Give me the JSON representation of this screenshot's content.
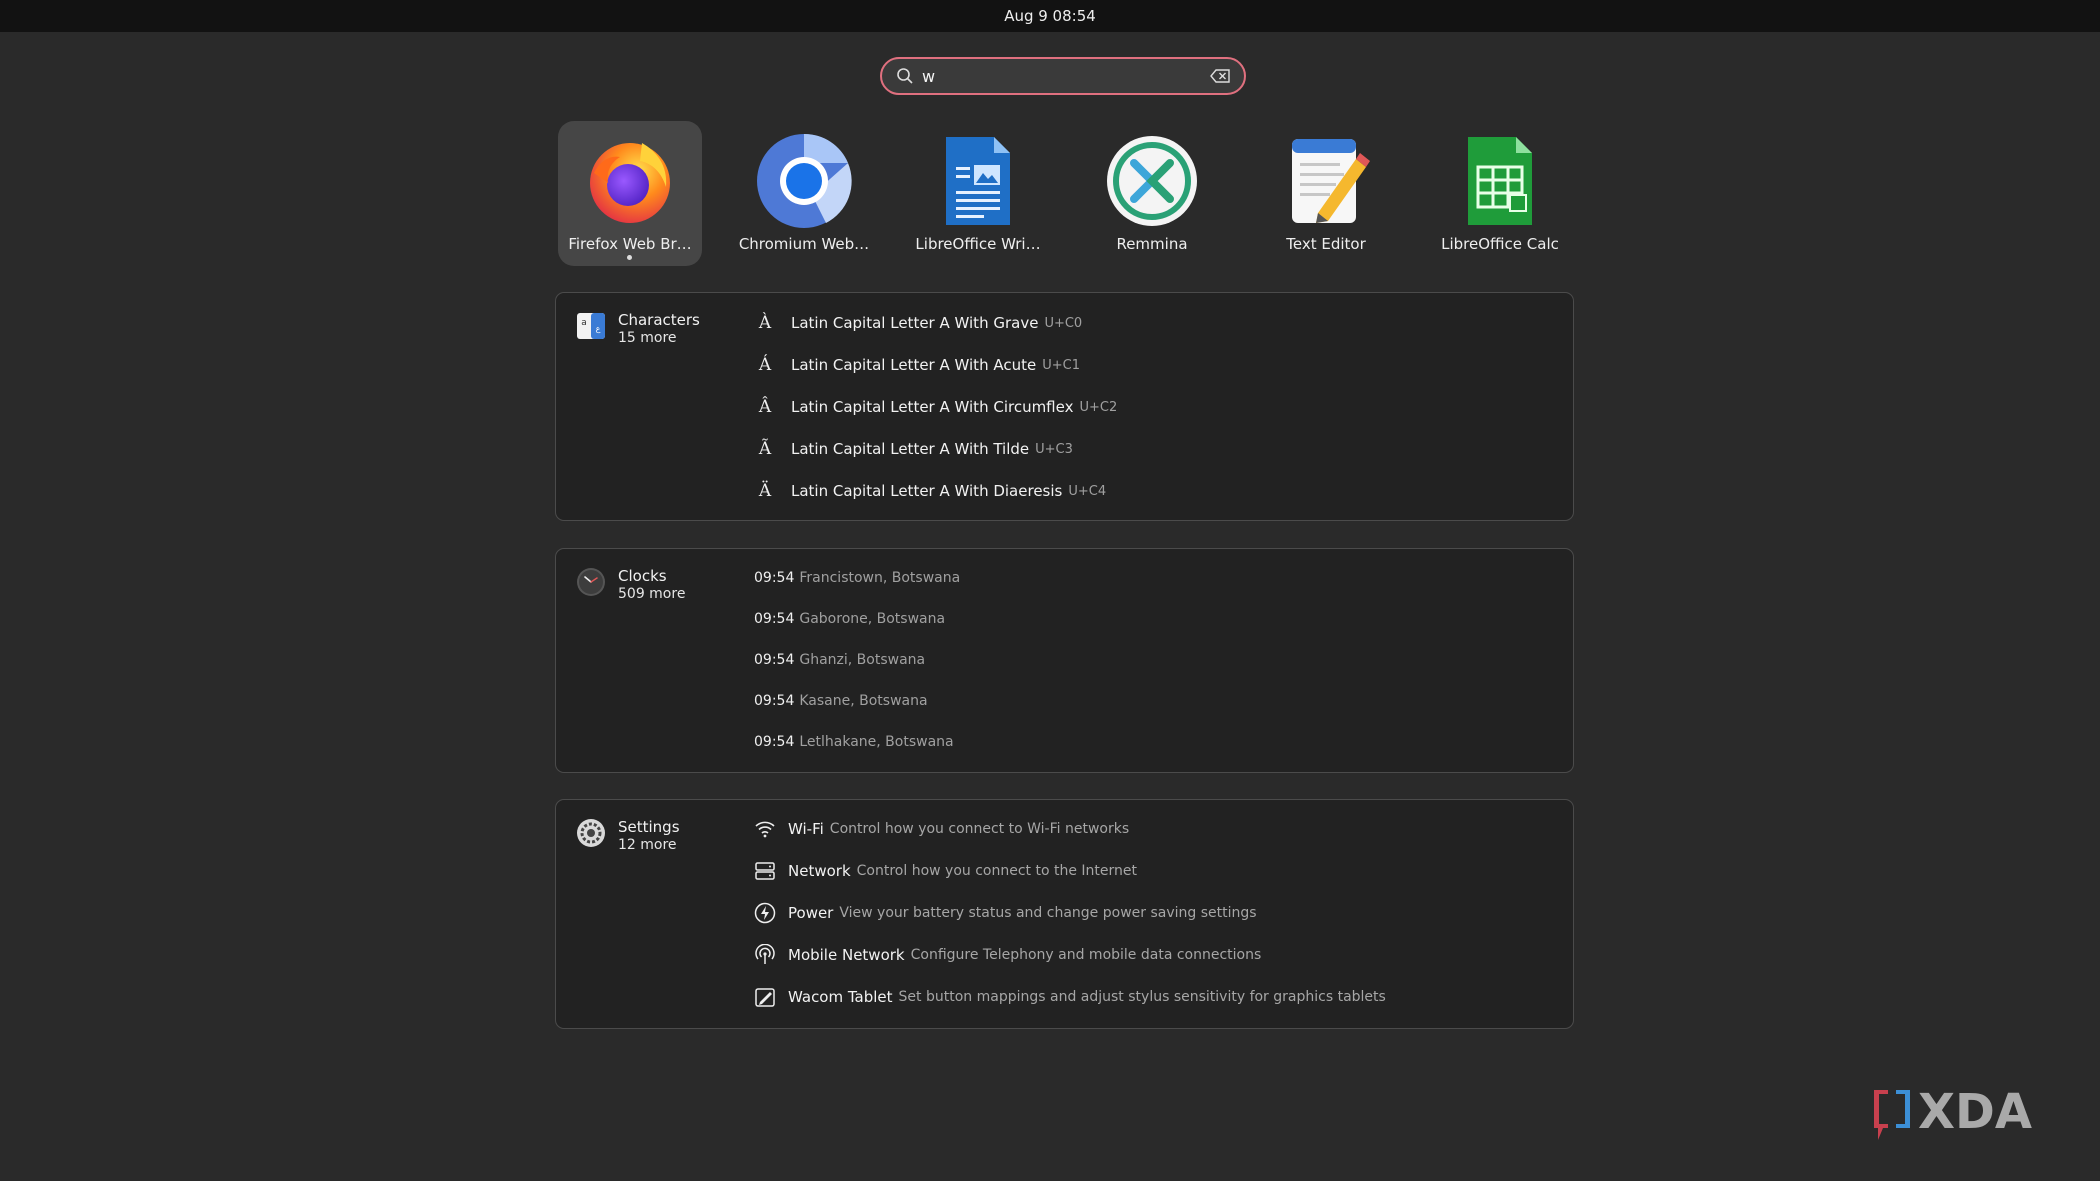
{
  "topbar": {
    "datetime": "Aug 9  08:54"
  },
  "search": {
    "value": "w"
  },
  "apps": [
    {
      "label": "Firefox Web Br…",
      "icon": "firefox-icon",
      "active": true
    },
    {
      "label": "Chromium Web…",
      "icon": "chromium-icon",
      "active": false
    },
    {
      "label": "LibreOffice Wri…",
      "icon": "libreoffice-writer-icon",
      "active": false
    },
    {
      "label": "Remmina",
      "icon": "remmina-icon",
      "active": false
    },
    {
      "label": "Text Editor",
      "icon": "text-editor-icon",
      "active": false
    },
    {
      "label": "LibreOffice Calc",
      "icon": "libreoffice-calc-icon",
      "active": false
    }
  ],
  "characters": {
    "name": "Characters",
    "more": "15 more",
    "items": [
      {
        "glyph": "À",
        "title": "Latin Capital Letter A With Grave",
        "code": "U+C0"
      },
      {
        "glyph": "Á",
        "title": "Latin Capital Letter A With Acute",
        "code": "U+C1"
      },
      {
        "glyph": "Â",
        "title": "Latin Capital Letter A With Circumflex",
        "code": "U+C2"
      },
      {
        "glyph": "Ã",
        "title": "Latin Capital Letter A With Tilde",
        "code": "U+C3"
      },
      {
        "glyph": "Ä",
        "title": "Latin Capital Letter A With Diaeresis",
        "code": "U+C4"
      }
    ]
  },
  "clocks": {
    "name": "Clocks",
    "more": "509 more",
    "items": [
      {
        "time": "09:54",
        "place": "Francistown, Botswana"
      },
      {
        "time": "09:54",
        "place": "Gaborone, Botswana"
      },
      {
        "time": "09:54",
        "place": "Ghanzi, Botswana"
      },
      {
        "time": "09:54",
        "place": "Kasane, Botswana"
      },
      {
        "time": "09:54",
        "place": "Letlhakane, Botswana"
      }
    ]
  },
  "settings": {
    "name": "Settings",
    "more": "12 more",
    "items": [
      {
        "icon": "wifi-icon",
        "title": "Wi-Fi",
        "desc": "Control how you connect to Wi-Fi networks"
      },
      {
        "icon": "network-icon",
        "title": "Network",
        "desc": "Control how you connect to the Internet"
      },
      {
        "icon": "power-icon",
        "title": "Power",
        "desc": "View your battery status and change power saving settings"
      },
      {
        "icon": "mobile-network-icon",
        "title": "Mobile Network",
        "desc": "Configure Telephony and mobile data connections"
      },
      {
        "icon": "wacom-tablet-icon",
        "title": "Wacom Tablet",
        "desc": "Set button mappings and adjust stylus sensitivity for graphics tablets"
      }
    ]
  },
  "watermark": {
    "text": "XDA"
  },
  "colors": {
    "background": "#2a2a2a",
    "topbar": "#121212",
    "search_border": "#e0707f",
    "panel": "#222222"
  }
}
